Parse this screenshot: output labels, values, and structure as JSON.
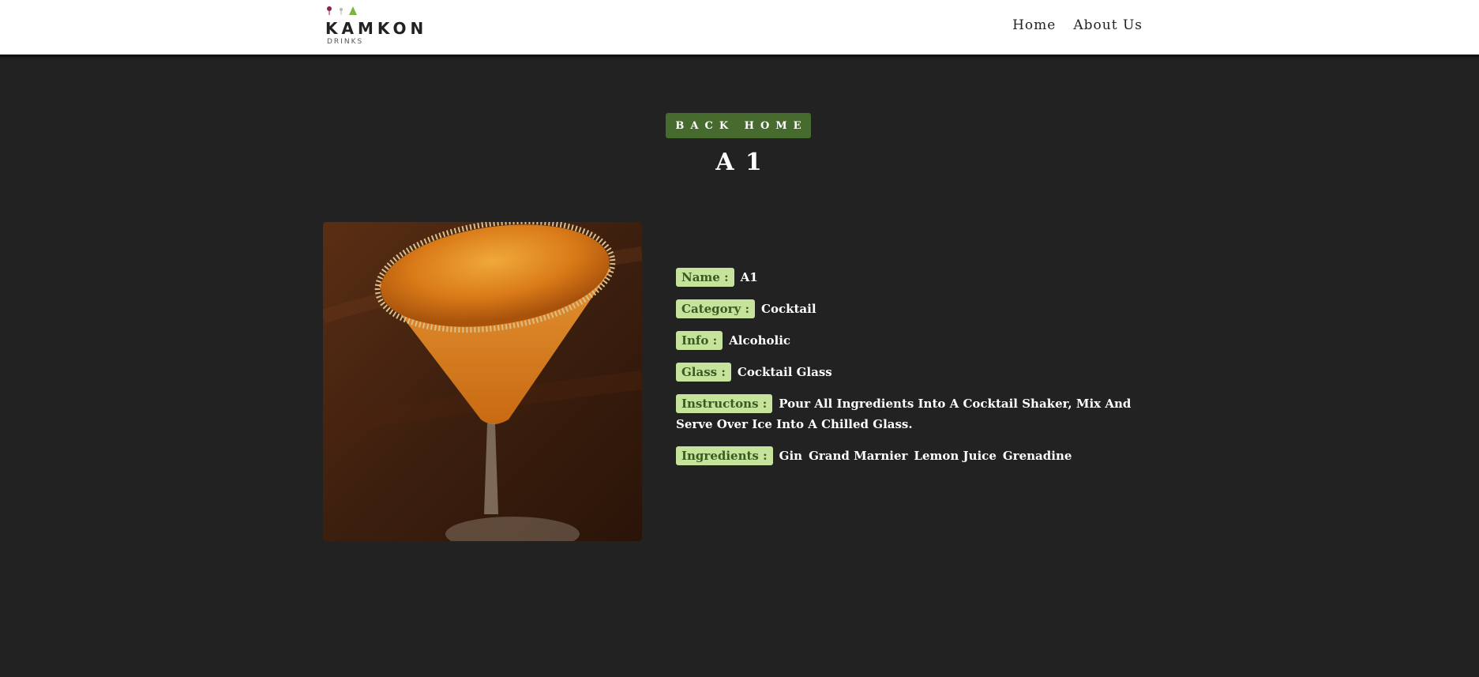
{
  "header": {
    "logo_name": "KAMKON",
    "logo_sub": "DRINKS",
    "nav": [
      {
        "label": "Home"
      },
      {
        "label": "About Us"
      }
    ]
  },
  "main": {
    "back_button_label": "BACK HOME",
    "title": "A 1",
    "details": {
      "name_label": "Name :",
      "name_value": "A1",
      "category_label": "Category :",
      "category_value": "Cocktail",
      "info_label": "Info :",
      "info_value": "Alcoholic",
      "glass_label": "Glass :",
      "glass_value": "Cocktail Glass",
      "instructions_label": "Instructons :",
      "instructions_value": "Pour All Ingredients Into A Cocktail Shaker, Mix And Serve Over Ice Into A Chilled Glass.",
      "ingredients_label": "Ingredients :",
      "ingredients": [
        "Gin",
        "Grand Marnier",
        "Lemon Juice",
        "Grenadine"
      ]
    }
  },
  "colors": {
    "background": "#222222",
    "accent_button": "#476b2e",
    "tag_background": "#c5e39b",
    "tag_text": "#3b5a22"
  }
}
